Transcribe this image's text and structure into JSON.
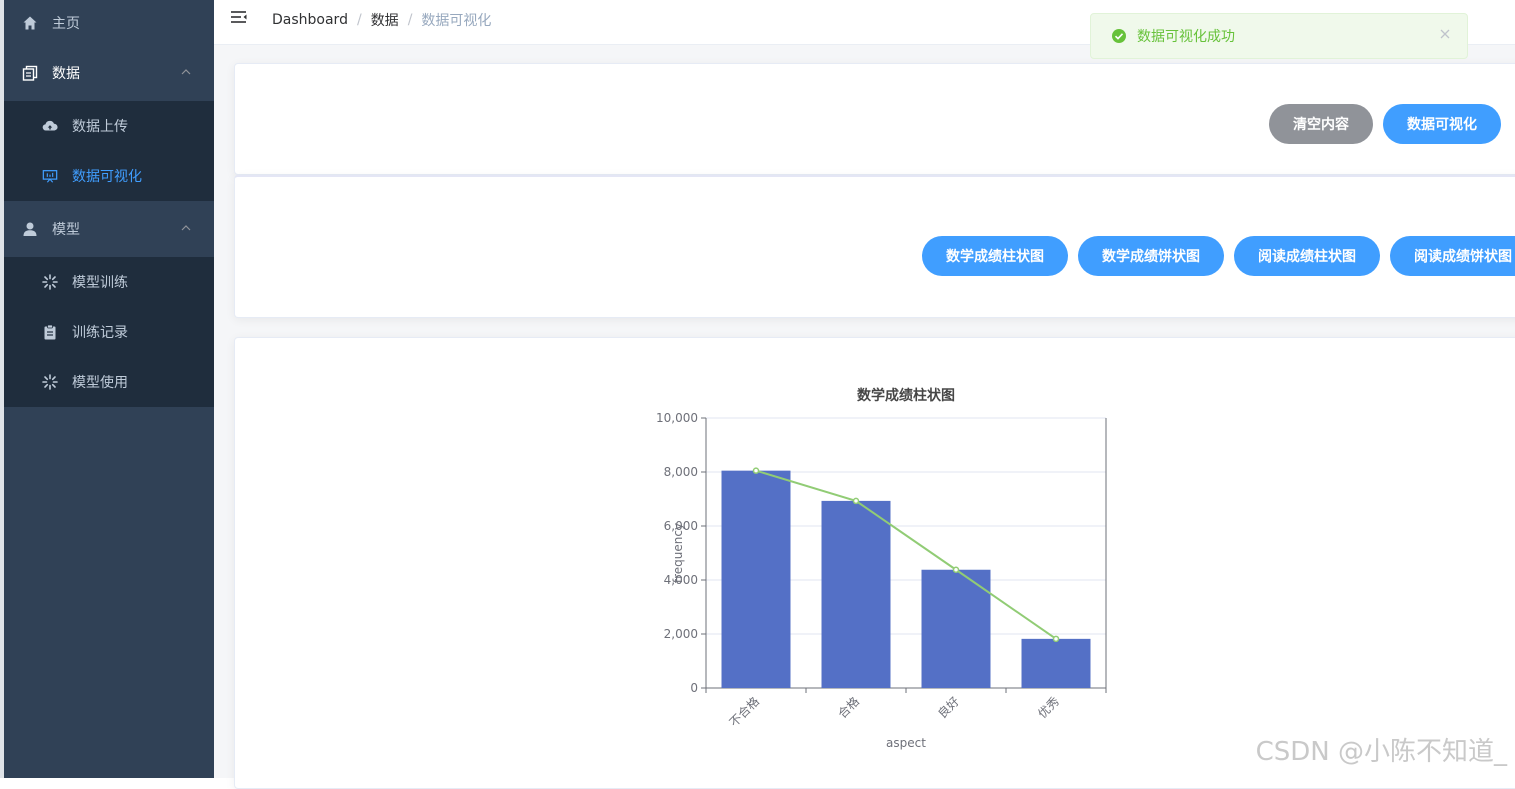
{
  "sidebar": {
    "home": "主页",
    "data_menu": "数据",
    "data_items": [
      {
        "label": "数据上传",
        "icon": "cloud-upload-icon"
      },
      {
        "label": "数据可视化",
        "icon": "presentation-chart-icon"
      }
    ],
    "model_menu": "模型",
    "model_items": [
      {
        "label": "模型训练",
        "icon": "loading-icon"
      },
      {
        "label": "训练记录",
        "icon": "clipboard-icon"
      },
      {
        "label": "模型使用",
        "icon": "loading-icon"
      }
    ]
  },
  "breadcrumb": [
    "Dashboard",
    "数据",
    "数据可视化"
  ],
  "toast": {
    "message": "数据可视化成功"
  },
  "actions": {
    "clear": "清空内容",
    "visualize": "数据可视化"
  },
  "chart_buttons": [
    "数学成绩柱状图",
    "数学成绩饼状图",
    "阅读成绩柱状图",
    "阅读成绩饼状图"
  ],
  "watermark": "CSDN @小陈不知道_",
  "colors": {
    "sidebar_bg": "#304156",
    "sidebar_sub_bg": "#1f2d3d",
    "active": "#409eff",
    "bar": "#5470c6",
    "line": "#91cc75",
    "success": "#67c23a"
  },
  "chart_data": {
    "type": "bar",
    "title": "数学成绩柱状图",
    "xlabel": "aspect",
    "ylabel": "frequency",
    "categories": [
      "不合格",
      "合格",
      "良好",
      "优秀"
    ],
    "series": [
      {
        "type": "bar",
        "values": [
          8050,
          6930,
          4380,
          1820
        ]
      },
      {
        "type": "line",
        "values": [
          8050,
          6930,
          4380,
          1820
        ]
      }
    ],
    "ylim": [
      0,
      10000
    ],
    "yticks": [
      0,
      2000,
      4000,
      6000,
      8000,
      10000
    ],
    "ytick_labels": [
      "0",
      "2,000",
      "4,000",
      "6,000",
      "8,000",
      "10,000"
    ],
    "grid": true
  }
}
